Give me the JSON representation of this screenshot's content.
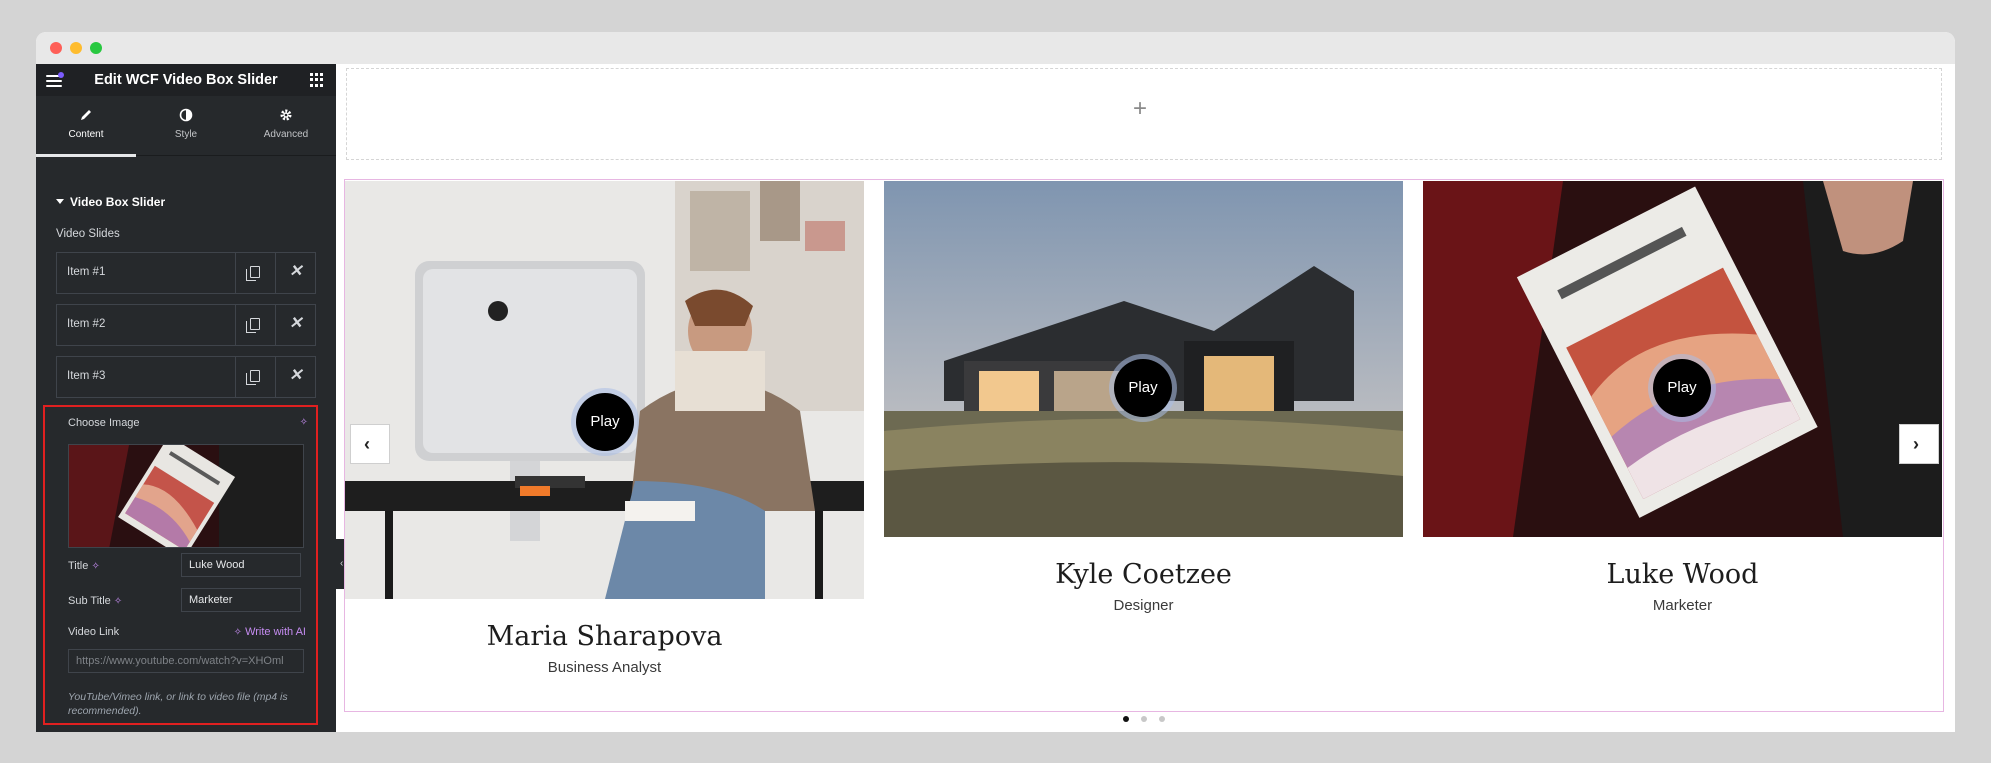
{
  "editor": {
    "title": "Edit WCF Video Box Slider",
    "tabs": [
      {
        "label": "Content",
        "icon": "pencil-icon"
      },
      {
        "label": "Style",
        "icon": "contrast-icon"
      },
      {
        "label": "Advanced",
        "icon": "gear-icon"
      }
    ],
    "section_title": "Video Box Slider",
    "slides_label": "Video Slides",
    "items": [
      {
        "label": "Item #1"
      },
      {
        "label": "Item #2"
      },
      {
        "label": "Item #3"
      }
    ],
    "expanded": {
      "choose_image": "Choose Image",
      "title_label": "Title",
      "title_value": "Luke Wood",
      "subtitle_label": "Sub Title",
      "subtitle_value": "Marketer",
      "video_link_label": "Video Link",
      "write_ai": "Write with AI",
      "video_link_value": "https://www.youtube.com/watch?v=XHOml",
      "hint": "YouTube/Vimeo link, or link to video file (mp4 is recommended)."
    }
  },
  "preview": {
    "add_symbol": "+",
    "slides": [
      {
        "name": "Maria Sharapova",
        "role": "Business Analyst",
        "play": "Play"
      },
      {
        "name": "Kyle Coetzee",
        "role": "Designer",
        "play": "Play"
      },
      {
        "name": "Luke Wood",
        "role": "Marketer",
        "play": "Play"
      }
    ],
    "prev_glyph": "‹",
    "next_glyph": "›",
    "active_bullet": 0,
    "bullet_count": 3
  },
  "colors": {
    "panel_bg": "#26292c",
    "accent_ai": "#c58cf1",
    "highlight_border": "#e02020",
    "widget_border": "#e7b6e2"
  }
}
